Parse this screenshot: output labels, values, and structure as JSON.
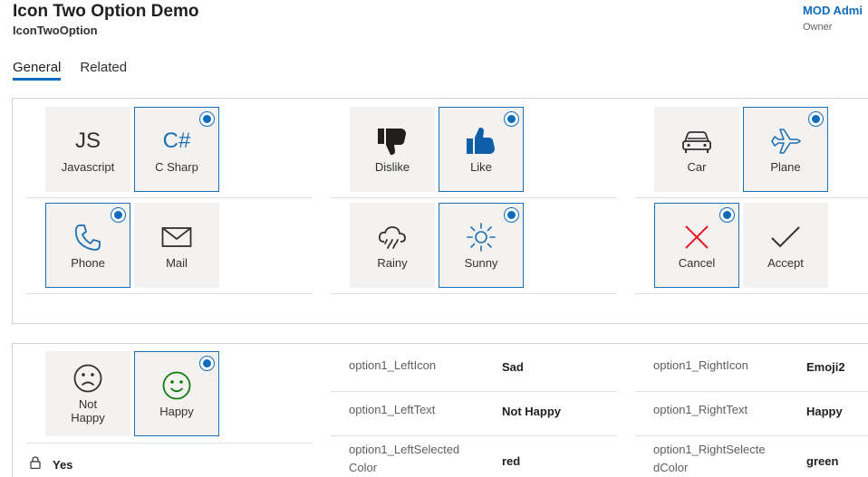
{
  "header": {
    "title": "Icon Two Option Demo",
    "subtitle": "IconTwoOption"
  },
  "owner": {
    "name": "MOD Admi",
    "label": "Owner"
  },
  "tabs": [
    {
      "label": "General"
    },
    {
      "label": "Related"
    }
  ],
  "options": {
    "javascript": {
      "icon": "JS",
      "label": "Javascript",
      "selected": false
    },
    "csharp": {
      "icon": "C#",
      "label": "C Sharp",
      "selected": true
    },
    "dislike": {
      "label": "Dislike",
      "selected": false
    },
    "like": {
      "label": "Like",
      "selected": true
    },
    "car": {
      "label": "Car",
      "selected": false
    },
    "plane": {
      "label": "Plane",
      "selected": true
    },
    "phone": {
      "label": "Phone",
      "selected": true
    },
    "mail": {
      "label": "Mail",
      "selected": false
    },
    "rainy": {
      "label": "Rainy",
      "selected": false
    },
    "sunny": {
      "label": "Sunny",
      "selected": true
    },
    "cancel": {
      "label": "Cancel",
      "selected": true
    },
    "accept": {
      "label": "Accept",
      "selected": false
    },
    "nothappy": {
      "label": "Not Happy",
      "selected": false
    },
    "happy": {
      "label": "Happy",
      "selected": true
    }
  },
  "colors": {
    "accent": "#0f6cbd",
    "cancel_red": "#e81123",
    "happy_green": "#107c10",
    "like_blue": "#0f5fa8"
  },
  "properties": {
    "left_icon_label": "option1_LeftIcon",
    "left_icon_value": "Sad",
    "left_text_label": "option1_LeftText",
    "left_text_value": "Not Happy",
    "left_color_label_1": "option1_LeftSelected",
    "left_color_label_2": "Color",
    "left_color_value": "red",
    "right_icon_label": "option1_RightIcon",
    "right_icon_value": "Emoji2",
    "right_text_label": "option1_RightText",
    "right_text_value": "Happy",
    "right_color_label_1": "option1_RightSelecte",
    "right_color_label_2": "dColor",
    "right_color_value": "green"
  },
  "locked_field": {
    "value": "Yes"
  }
}
